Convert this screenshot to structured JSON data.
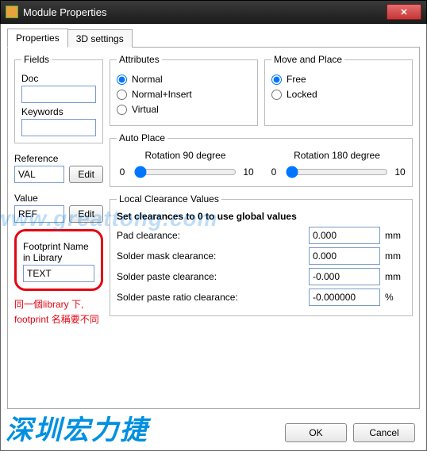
{
  "window": {
    "title": "Module Properties"
  },
  "tabs": {
    "active": "Properties",
    "other": "3D settings"
  },
  "fields": {
    "legend": "Fields",
    "doc_label": "Doc",
    "doc_value": "",
    "keywords_label": "Keywords",
    "keywords_value": "",
    "reference_label": "Reference",
    "reference_value": "VAL",
    "value_label": "Value",
    "value_value": "REF",
    "edit_btn": "Edit"
  },
  "footprint": {
    "label": "Footprint Name in Library",
    "value": "TEXT"
  },
  "annotation": {
    "line1": "同一個library 下,",
    "line2": "footprint 名稱要不同"
  },
  "attributes": {
    "legend": "Attributes",
    "normal": "Normal",
    "normal_insert": "Normal+Insert",
    "virtual": "Virtual",
    "selected": "normal"
  },
  "move_place": {
    "legend": "Move and Place",
    "free": "Free",
    "locked": "Locked",
    "selected": "free"
  },
  "autoplace": {
    "legend": "Auto Place",
    "rot90_label": "Rotation 90 degree",
    "rot180_label": "Rotation 180 degree",
    "min": "0",
    "max": "10",
    "rot90_value": "0",
    "rot180_value": "0"
  },
  "clearances": {
    "legend": "Local Clearance Values",
    "hint": "Set clearances to 0 to use global values",
    "rows": [
      {
        "label": "Pad clearance:",
        "value": "0.000",
        "unit": "mm"
      },
      {
        "label": "Solder mask clearance:",
        "value": "0.000",
        "unit": "mm"
      },
      {
        "label": "Solder paste clearance:",
        "value": "-0.000",
        "unit": "mm"
      },
      {
        "label": "Solder paste ratio clearance:",
        "value": "-0.000000",
        "unit": "%"
      }
    ]
  },
  "buttons": {
    "ok": "OK",
    "cancel": "Cancel"
  },
  "watermark": {
    "domain": "www.greattong.com",
    "cn": "深圳宏力捷"
  }
}
